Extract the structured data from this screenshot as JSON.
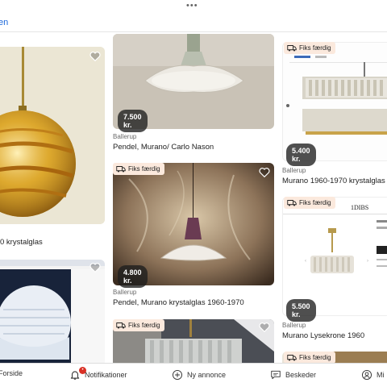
{
  "topbar": {
    "dots": "•••",
    "back_label": "en"
  },
  "listings": [
    {
      "location": "",
      "title": "0 krystalglas",
      "price": "",
      "badge": ""
    },
    {
      "location": "Ballerup",
      "title": "Pendel, Murano/ Carlo Nason",
      "price": "7.500 kr.",
      "badge": ""
    },
    {
      "location": "Ballerup",
      "title": "Murano 1960-1970 krystalglas",
      "price": "5.400 kr.",
      "badge": "Fiks færdig"
    },
    {
      "location": "Ballerup",
      "title": "Pendel, Murano krystalglas 1960-1970",
      "price": "4.800 kr.",
      "badge": "Fiks færdig"
    },
    {
      "location": "Ballerup",
      "title": "Murano Lysekrone 1960",
      "price": "5.500 kr.",
      "badge": "Fiks færdig"
    },
    {
      "location": "",
      "title": "",
      "price": "",
      "badge": "Fiks færdig"
    },
    {
      "location": "",
      "title": "",
      "price": "",
      "badge": "Fiks færdig"
    },
    {
      "location": "",
      "title": "",
      "price": "",
      "badge": ""
    }
  ],
  "screenshot_text": {
    "dibs": "1DIBS"
  },
  "nav": {
    "home": "Forside",
    "notifications": "Notifikationer",
    "notifications_badge": "•",
    "new_ad": "Ny annonce",
    "messages": "Beskeder",
    "profile": "Mi"
  },
  "colors": {
    "badge_bg": "#fbe9dd",
    "link": "#1a66d9",
    "notif": "#d93025"
  }
}
